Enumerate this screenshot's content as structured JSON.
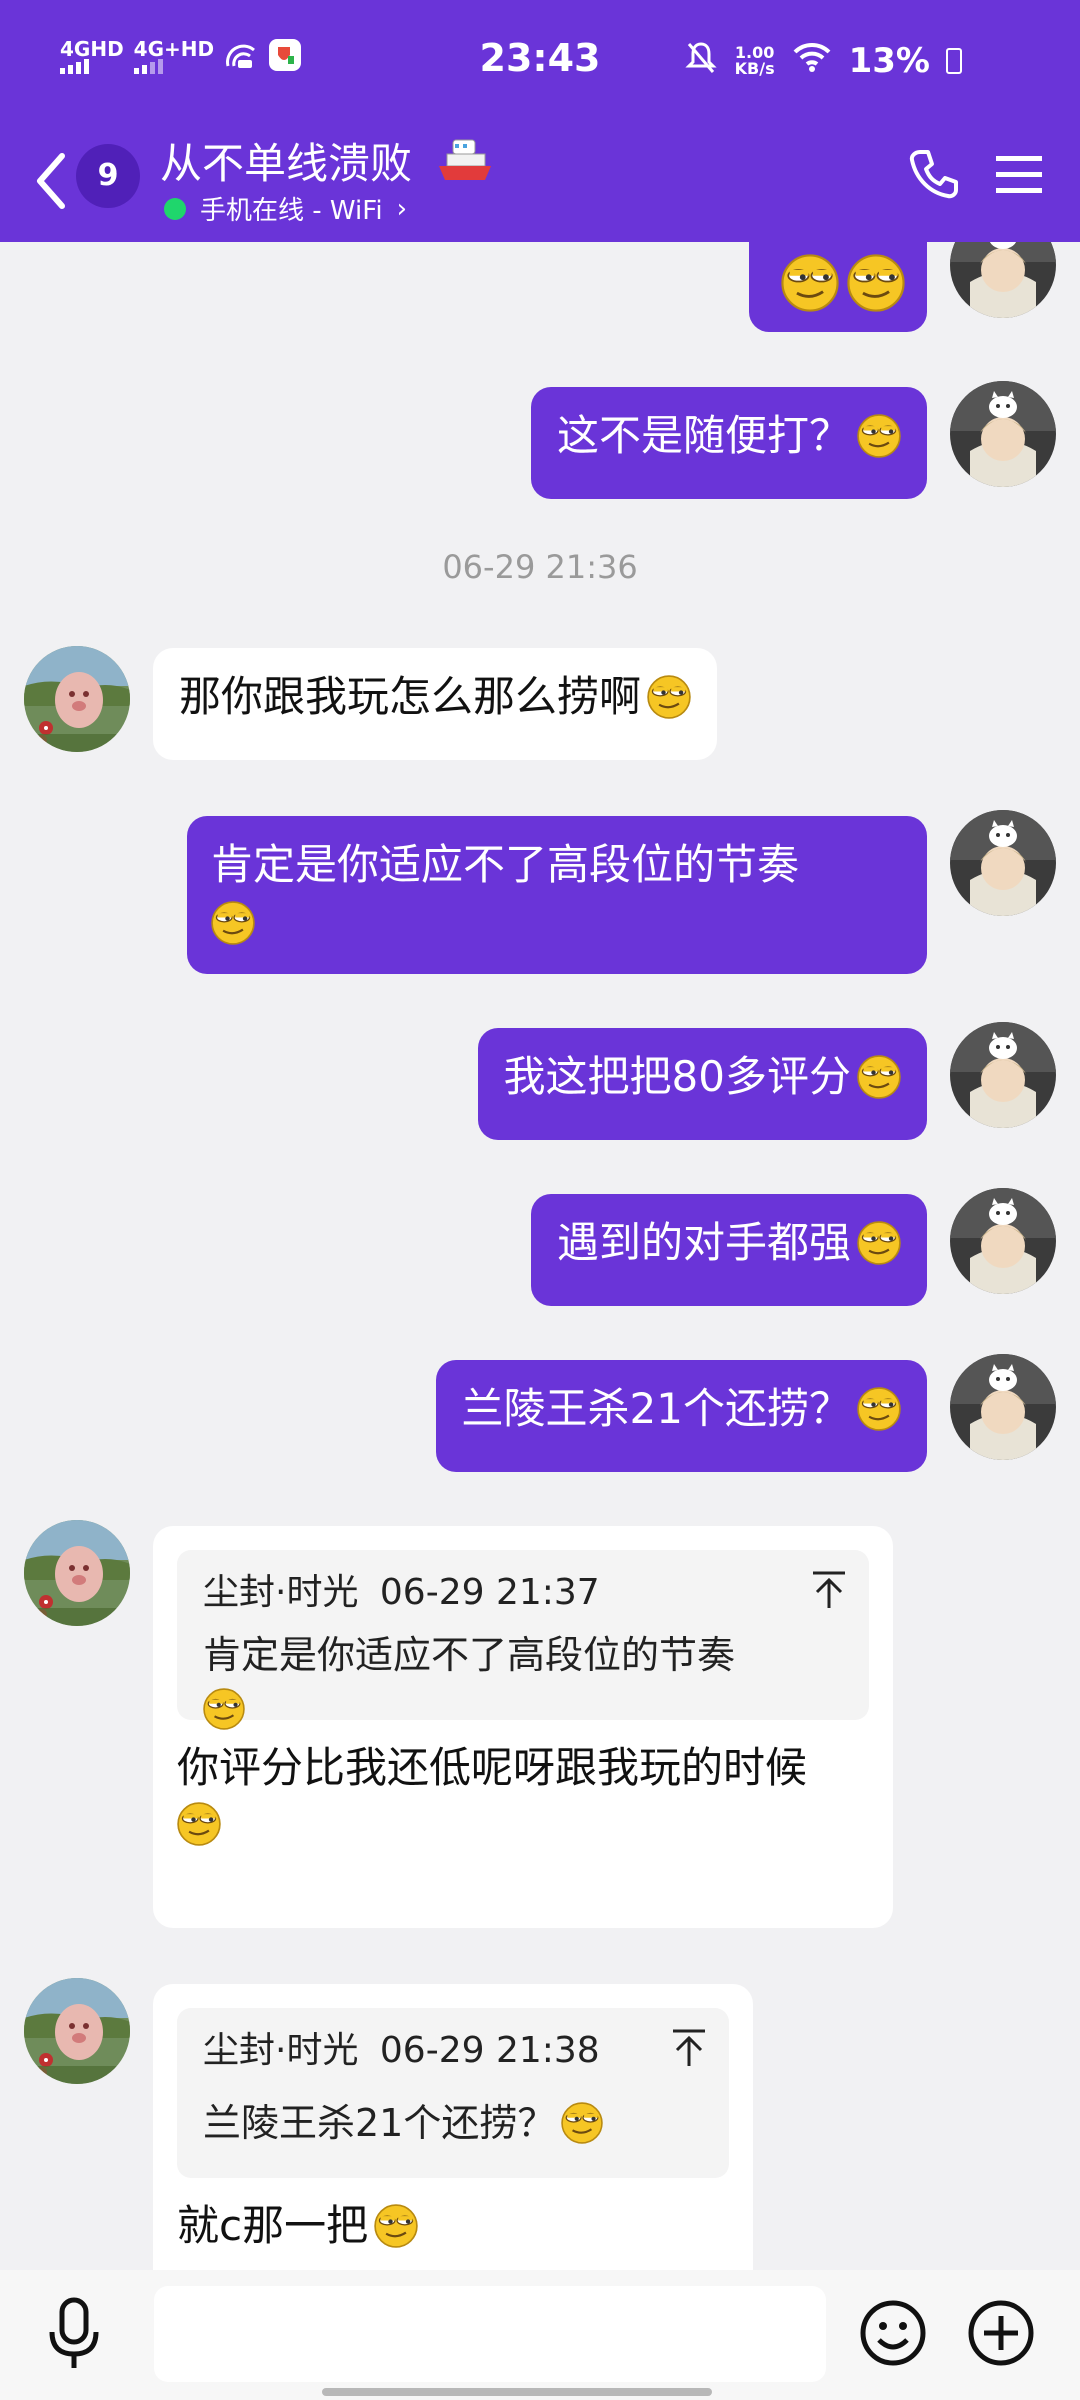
{
  "status_bar": {
    "network1": "4GHD",
    "network2": "4G+HD",
    "time": "23:43",
    "speed_value": "1.00",
    "speed_unit": "KB/s",
    "battery": "13%"
  },
  "header": {
    "unread_count": "9",
    "chat_title": "从不单线溃败",
    "online_status": "手机在线 - WiFi",
    "accent_color": "#6a34d8"
  },
  "messages": [
    {
      "side": "out",
      "text": ""
    },
    {
      "side": "out",
      "text": "这不是随便打？"
    },
    {
      "side": "time",
      "text": "06-29 21:36"
    },
    {
      "side": "in",
      "text": "那你跟我玩怎么那么捞啊"
    },
    {
      "side": "out",
      "text": "肯定是你适应不了高段位的节奏"
    },
    {
      "side": "out",
      "text": "我这把把80多评分"
    },
    {
      "side": "out",
      "text": "遇到的对手都强"
    },
    {
      "side": "out",
      "text": "兰陵王杀21个还捞？"
    },
    {
      "side": "in",
      "quote_sender": "尘封·时光",
      "quote_time": "06-29 21:37",
      "quote_text": "肯定是你适应不了高段位的节奏",
      "text": "你评分比我还低呢呀跟我玩的时候"
    },
    {
      "side": "in",
      "quote_sender": "尘封·时光",
      "quote_time": "06-29 21:38",
      "quote_text": "兰陵王杀21个还捞？",
      "text": "就c那一把"
    }
  ],
  "input_bar": {
    "placeholder": "",
    "icons": [
      "microphone-icon",
      "emoji-icon",
      "plus-icon"
    ]
  }
}
